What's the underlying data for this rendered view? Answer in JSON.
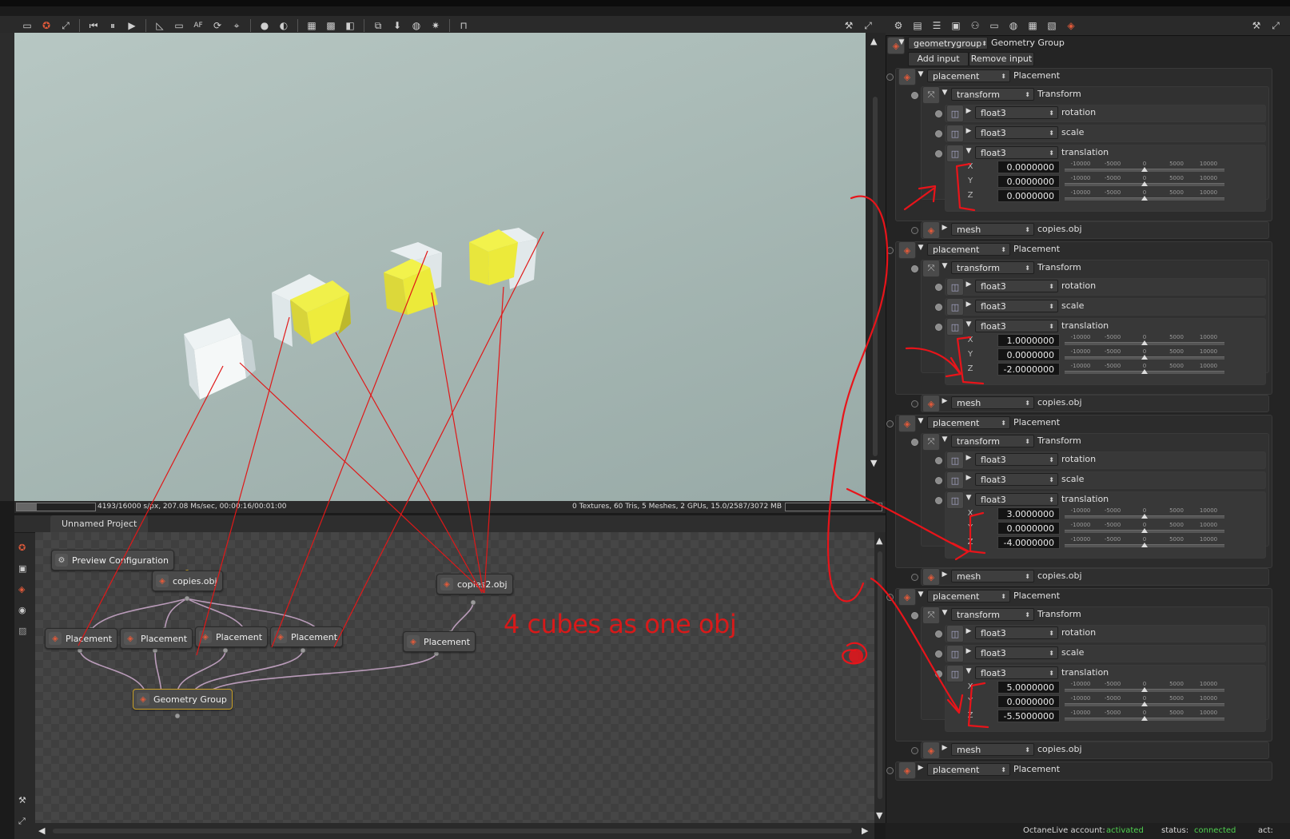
{
  "toolbar": {
    "left_icons": [
      "render-target-icon",
      "camera-icon",
      "fit-icon",
      "rewind-icon",
      "pause-icon",
      "play-icon",
      "pick-icon",
      "region-icon",
      "af-icon",
      "rotate-icon",
      "focus-icon",
      "sphere-icon",
      "sphere2-icon",
      "clay-icon",
      "checker-icon",
      "alpha-icon",
      "copy-icon",
      "save-icon",
      "palette-icon",
      "sun-icon",
      "lock-icon"
    ],
    "left_glyphs": [
      "▭",
      "✪",
      "⤢",
      "⏮",
      "⏸",
      "▶",
      "◺",
      "▭",
      "AF",
      "⟳",
      "⌖",
      "●",
      "◐",
      "▦",
      "▩",
      "◧",
      "⧉",
      "⬇",
      "◍",
      "✷",
      "⊓"
    ],
    "right_glyphs": [
      "⚒",
      "⤢"
    ]
  },
  "status": {
    "left": "4193/16000 s/px, 207.08 Ms/sec, 00:00:16/00:01:00",
    "right": "0 Textures, 60 Tris, 5 Meshes, 2 GPUs, 15.0/2587/3072 MB",
    "progress": 0.26
  },
  "graph": {
    "tab": "Unnamed Project",
    "preview_button": "Preview Configuration",
    "nodes": {
      "copies_obj": "copies.obj",
      "copies2_obj": "copies2.obj",
      "placement1": "Placement",
      "placement2": "Placement",
      "placement3": "Placement",
      "placement4": "Placement",
      "placement5": "Placement",
      "geometry_group": "Geometry Group"
    },
    "annotation": "4 cubes as one obj"
  },
  "panel": {
    "root_combo": "geometrygroup",
    "root_label": "Geometry Group",
    "add_input": "Add input",
    "remove_input": "Remove input",
    "slider_ticks": [
      "-10000",
      "-5000",
      "0",
      "5000",
      "10000"
    ],
    "blocks": [
      {
        "placement_combo": "placement",
        "placement_label": "Placement",
        "transform_combo": "transform",
        "transform_label": "Transform",
        "rot_combo": "float3",
        "rot_label": "rotation",
        "scale_combo": "float3",
        "scale_label": "scale",
        "trans_combo": "float3",
        "trans_label": "translation",
        "x": "0.0000000",
        "y": "0.0000000",
        "z": "0.0000000",
        "mesh_combo": "mesh",
        "mesh_label": "copies.obj"
      },
      {
        "placement_combo": "placement",
        "placement_label": "Placement",
        "transform_combo": "transform",
        "transform_label": "Transform",
        "rot_combo": "float3",
        "rot_label": "rotation",
        "scale_combo": "float3",
        "scale_label": "scale",
        "trans_combo": "float3",
        "trans_label": "translation",
        "x": "1.0000000",
        "y": "0.0000000",
        "z": "-2.0000000",
        "mesh_combo": "mesh",
        "mesh_label": "copies.obj"
      },
      {
        "placement_combo": "placement",
        "placement_label": "Placement",
        "transform_combo": "transform",
        "transform_label": "Transform",
        "rot_combo": "float3",
        "rot_label": "rotation",
        "scale_combo": "float3",
        "scale_label": "scale",
        "trans_combo": "float3",
        "trans_label": "translation",
        "x": "3.0000000",
        "y": "0.0000000",
        "z": "-4.0000000",
        "mesh_combo": "mesh",
        "mesh_label": "copies.obj"
      },
      {
        "placement_combo": "placement",
        "placement_label": "Placement",
        "transform_combo": "transform",
        "transform_label": "Transform",
        "rot_combo": "float3",
        "rot_label": "rotation",
        "scale_combo": "float3",
        "scale_label": "scale",
        "trans_combo": "float3",
        "trans_label": "translation",
        "x": "5.0000000",
        "y": "0.0000000",
        "z": "-5.5000000",
        "mesh_combo": "mesh",
        "mesh_label": "copies.obj"
      }
    ],
    "last_combo": "placement",
    "last_label": "Placement",
    "axis_x": "X",
    "axis_y": "Y",
    "axis_z": "Z"
  },
  "footer": {
    "account_label": "OctaneLive account:",
    "account_value": "activated",
    "status_label": "status:",
    "status_value": "connected",
    "act_label": "act:"
  },
  "colors": {
    "annotation": "#e01818",
    "accent_green": "#4fd04f",
    "node_selected": "#c8a028",
    "cube_yellow": "#e8e83a",
    "cube_white": "#e8eef0"
  }
}
